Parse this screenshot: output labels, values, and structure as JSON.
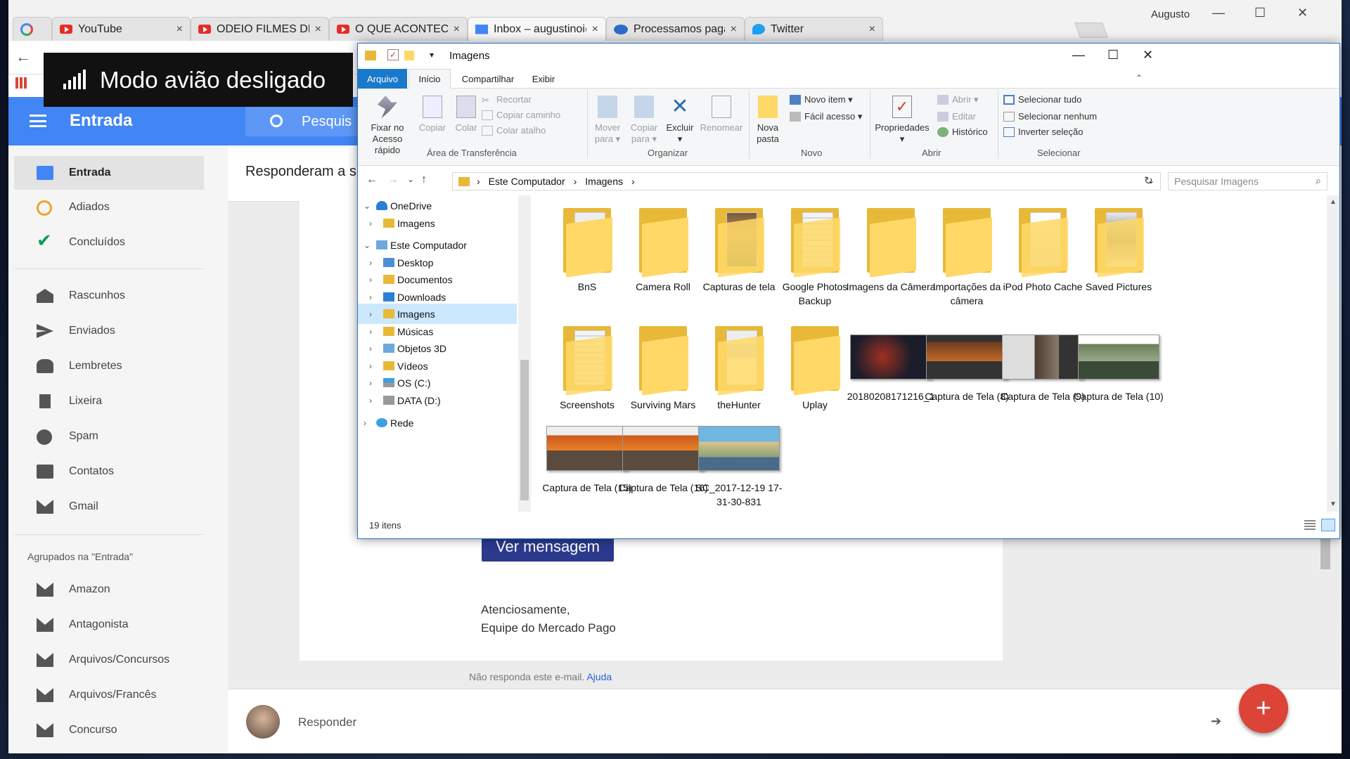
{
  "browser": {
    "tabs": [
      {
        "label": "",
        "icon": "google-icon"
      },
      {
        "label": "YouTube",
        "icon": "youtube-icon"
      },
      {
        "label": "ODEIO FILMES DE GAME",
        "icon": "youtube-icon"
      },
      {
        "label": "O QUE ACONTECE SE VO",
        "icon": "youtube-icon"
      },
      {
        "label": "Inbox – augustinoi@gma",
        "icon": "inbox-icon"
      },
      {
        "label": "Processamos pagamento",
        "icon": "mercadopago-icon"
      },
      {
        "label": "Twitter",
        "icon": "twitter-icon"
      }
    ],
    "user": "Augusto",
    "close_glyph": "×",
    "window_controls": {
      "minimize": "—",
      "maximize": "☐",
      "close": "✕"
    }
  },
  "toast": {
    "text": "Modo avião desligado"
  },
  "inbox": {
    "header_title": "Entrada",
    "search_placeholder": "Pesquis",
    "nav": [
      {
        "label": "Entrada",
        "icon": "inbox-tray-icon",
        "selected": true
      },
      {
        "label": "Adiados",
        "icon": "clock-icon"
      },
      {
        "label": "Concluídos",
        "icon": "check-icon"
      },
      {
        "label": "Rascunhos",
        "icon": "drafts-icon"
      },
      {
        "label": "Enviados",
        "icon": "send-icon"
      },
      {
        "label": "Lembretes",
        "icon": "reminder-icon"
      },
      {
        "label": "Lixeira",
        "icon": "trash-icon"
      },
      {
        "label": "Spam",
        "icon": "spam-icon"
      },
      {
        "label": "Contatos",
        "icon": "contacts-icon"
      },
      {
        "label": "Gmail",
        "icon": "gmail-icon"
      }
    ],
    "group_header": "Agrupados na \"Entrada\"",
    "groups": [
      "Amazon",
      "Antagonista",
      "Arquivos/Concursos",
      "Arquivos/Francês",
      "Concurso"
    ],
    "thread_title": "Responderam a su",
    "message": {
      "button": "Ver mensagem",
      "regards_line1": "Atenciosamente,",
      "regards_line2": "Equipe do Mercado Pago",
      "footer_text": "Não responda este e-mail.",
      "footer_link": "Ajuda"
    },
    "reply_label": "Responder",
    "fab": "+"
  },
  "explorer": {
    "title": "Imagens",
    "ribbon_tabs": [
      "Arquivo",
      "Início",
      "Compartilhar",
      "Exibir"
    ],
    "clipboard": {
      "pin": "Fixar no\nAcesso rápido",
      "copy": "Copiar",
      "paste": "Colar",
      "cut": "Recortar",
      "copy_path": "Copiar caminho",
      "paste_shortcut": "Colar atalho",
      "group": "Área de Transferência"
    },
    "organize": {
      "move": "Mover\npara ▾",
      "copy_to": "Copiar\npara ▾",
      "delete": "Excluir\n▾",
      "rename": "Renomear",
      "group": "Organizar"
    },
    "new": {
      "new_folder": "Nova\npasta",
      "new_item": "Novo item ▾",
      "easy_access": "Fácil acesso ▾",
      "group": "Novo"
    },
    "open": {
      "properties": "Propriedades\n▾",
      "open": "Abrir ▾",
      "edit": "Editar",
      "history": "Histórico",
      "group": "Abrir"
    },
    "select": {
      "all": "Selecionar tudo",
      "none": "Selecionar nenhum",
      "invert": "Inverter seleção",
      "group": "Selecionar"
    },
    "breadcrumb": [
      "Este Computador",
      "Imagens"
    ],
    "search_placeholder": "Pesquisar Imagens",
    "tree": [
      {
        "label": "OneDrive",
        "icon": "onedrive-icon",
        "level": 0,
        "expanded": true
      },
      {
        "label": "Imagens",
        "icon": "folder-icon",
        "level": 1
      },
      {
        "label": "Este Computador",
        "icon": "computer-icon",
        "level": 0,
        "expanded": true
      },
      {
        "label": "Desktop",
        "icon": "folder-icon",
        "level": 1
      },
      {
        "label": "Documentos",
        "icon": "folder-icon",
        "level": 1
      },
      {
        "label": "Downloads",
        "icon": "folder-icon",
        "level": 1
      },
      {
        "label": "Imagens",
        "icon": "folder-icon",
        "level": 1,
        "selected": true
      },
      {
        "label": "Músicas",
        "icon": "folder-icon",
        "level": 1
      },
      {
        "label": "Objetos 3D",
        "icon": "folder-icon",
        "level": 1
      },
      {
        "label": "Vídeos",
        "icon": "folder-icon",
        "level": 1
      },
      {
        "label": "OS (C:)",
        "icon": "drive-icon",
        "level": 1
      },
      {
        "label": "DATA (D:)",
        "icon": "drive-icon",
        "level": 1
      },
      {
        "label": "Rede",
        "icon": "network-icon",
        "level": 0
      }
    ],
    "items": [
      {
        "name": "BnS",
        "kind": "folder"
      },
      {
        "name": "Camera Roll",
        "kind": "folder"
      },
      {
        "name": "Capturas de tela",
        "kind": "folder"
      },
      {
        "name": "Google Photos Backup",
        "kind": "folder"
      },
      {
        "name": "Imagens da Câmera",
        "kind": "folder"
      },
      {
        "name": "Importações da câmera",
        "kind": "folder"
      },
      {
        "name": "iPod Photo Cache",
        "kind": "folder"
      },
      {
        "name": "Saved Pictures",
        "kind": "folder"
      },
      {
        "name": "Screenshots",
        "kind": "folder"
      },
      {
        "name": "Surviving Mars",
        "kind": "folder"
      },
      {
        "name": "theHunter",
        "kind": "folder"
      },
      {
        "name": "Uplay",
        "kind": "folder"
      },
      {
        "name": "20180208171216_1",
        "kind": "image"
      },
      {
        "name": "Captura de Tela (8)",
        "kind": "image"
      },
      {
        "name": "Captura de Tela (9)",
        "kind": "image"
      },
      {
        "name": "Captura de Tela (10)",
        "kind": "image"
      },
      {
        "name": "Captura de Tela (15)",
        "kind": "image"
      },
      {
        "name": "Captura de Tela (16)",
        "kind": "image"
      },
      {
        "name": "SC_2017-12-19 17-31-30-831",
        "kind": "image"
      }
    ],
    "status": "19 itens"
  }
}
